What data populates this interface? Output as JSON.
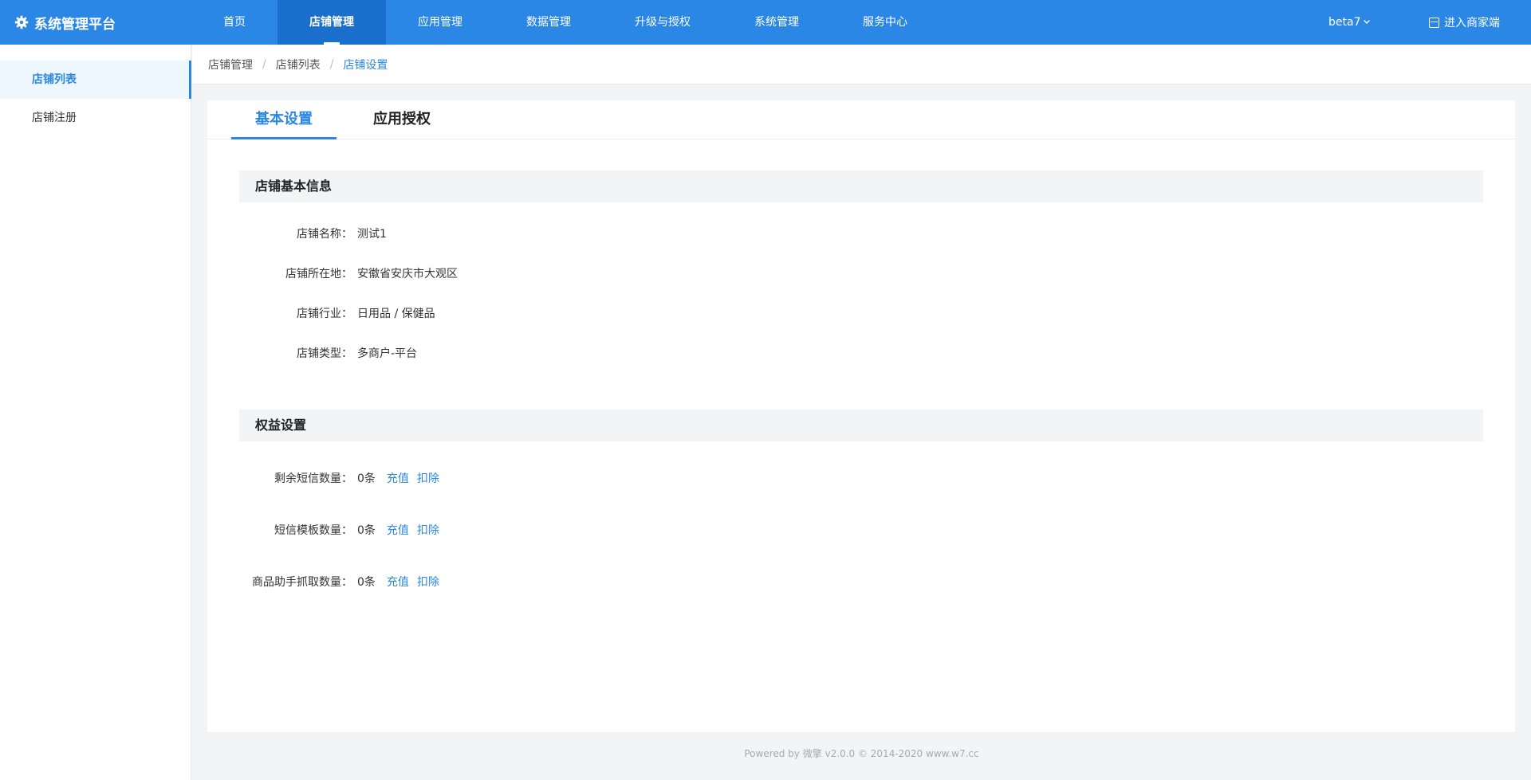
{
  "topbar": {
    "brand": "系统管理平台",
    "nav": [
      "首页",
      "店铺管理",
      "应用管理",
      "数据管理",
      "升级与授权",
      "系统管理",
      "服务中心"
    ],
    "active_nav": "店铺管理",
    "env": "beta7",
    "merchant_link": "进入商家端"
  },
  "sidebar": {
    "items": [
      "店铺列表",
      "店铺注册"
    ],
    "active_item": "店铺列表"
  },
  "breadcrumb": [
    "店铺管理",
    "店铺列表",
    "店铺设置"
  ],
  "tabs": [
    "基本设置",
    "应用授权"
  ],
  "active_tab": "基本设置",
  "basic_info": {
    "title": "店铺基本信息",
    "rows": [
      {
        "label": "店铺名称：",
        "value": "测试1"
      },
      {
        "label": "店铺所在地：",
        "value": "安徽省安庆市大观区"
      },
      {
        "label": "店铺行业：",
        "value": "日用品 / 保健品"
      },
      {
        "label": "店铺类型：",
        "value": "多商户-平台"
      }
    ]
  },
  "benefits": {
    "title": "权益设置",
    "rows": [
      {
        "label": "剩余短信数量：",
        "value": "0条",
        "recharge": "充值",
        "deduct": "扣除"
      },
      {
        "label": "短信模板数量：",
        "value": "0条",
        "recharge": "充值",
        "deduct": "扣除"
      },
      {
        "label": "商品助手抓取数量：",
        "value": "0条",
        "recharge": "充值",
        "deduct": "扣除"
      }
    ]
  },
  "footer": "Powered by 微擎 v2.0.0 © 2014-2020 www.w7.cc",
  "colors": {
    "primary": "#2b87e5",
    "active_nav_bg": "#1b6fcc",
    "panel_bg": "#f3f4f6"
  },
  "icons": {
    "brand": "gear-icon",
    "env_caret": "chevron-down-icon",
    "merchant": "store-icon"
  }
}
